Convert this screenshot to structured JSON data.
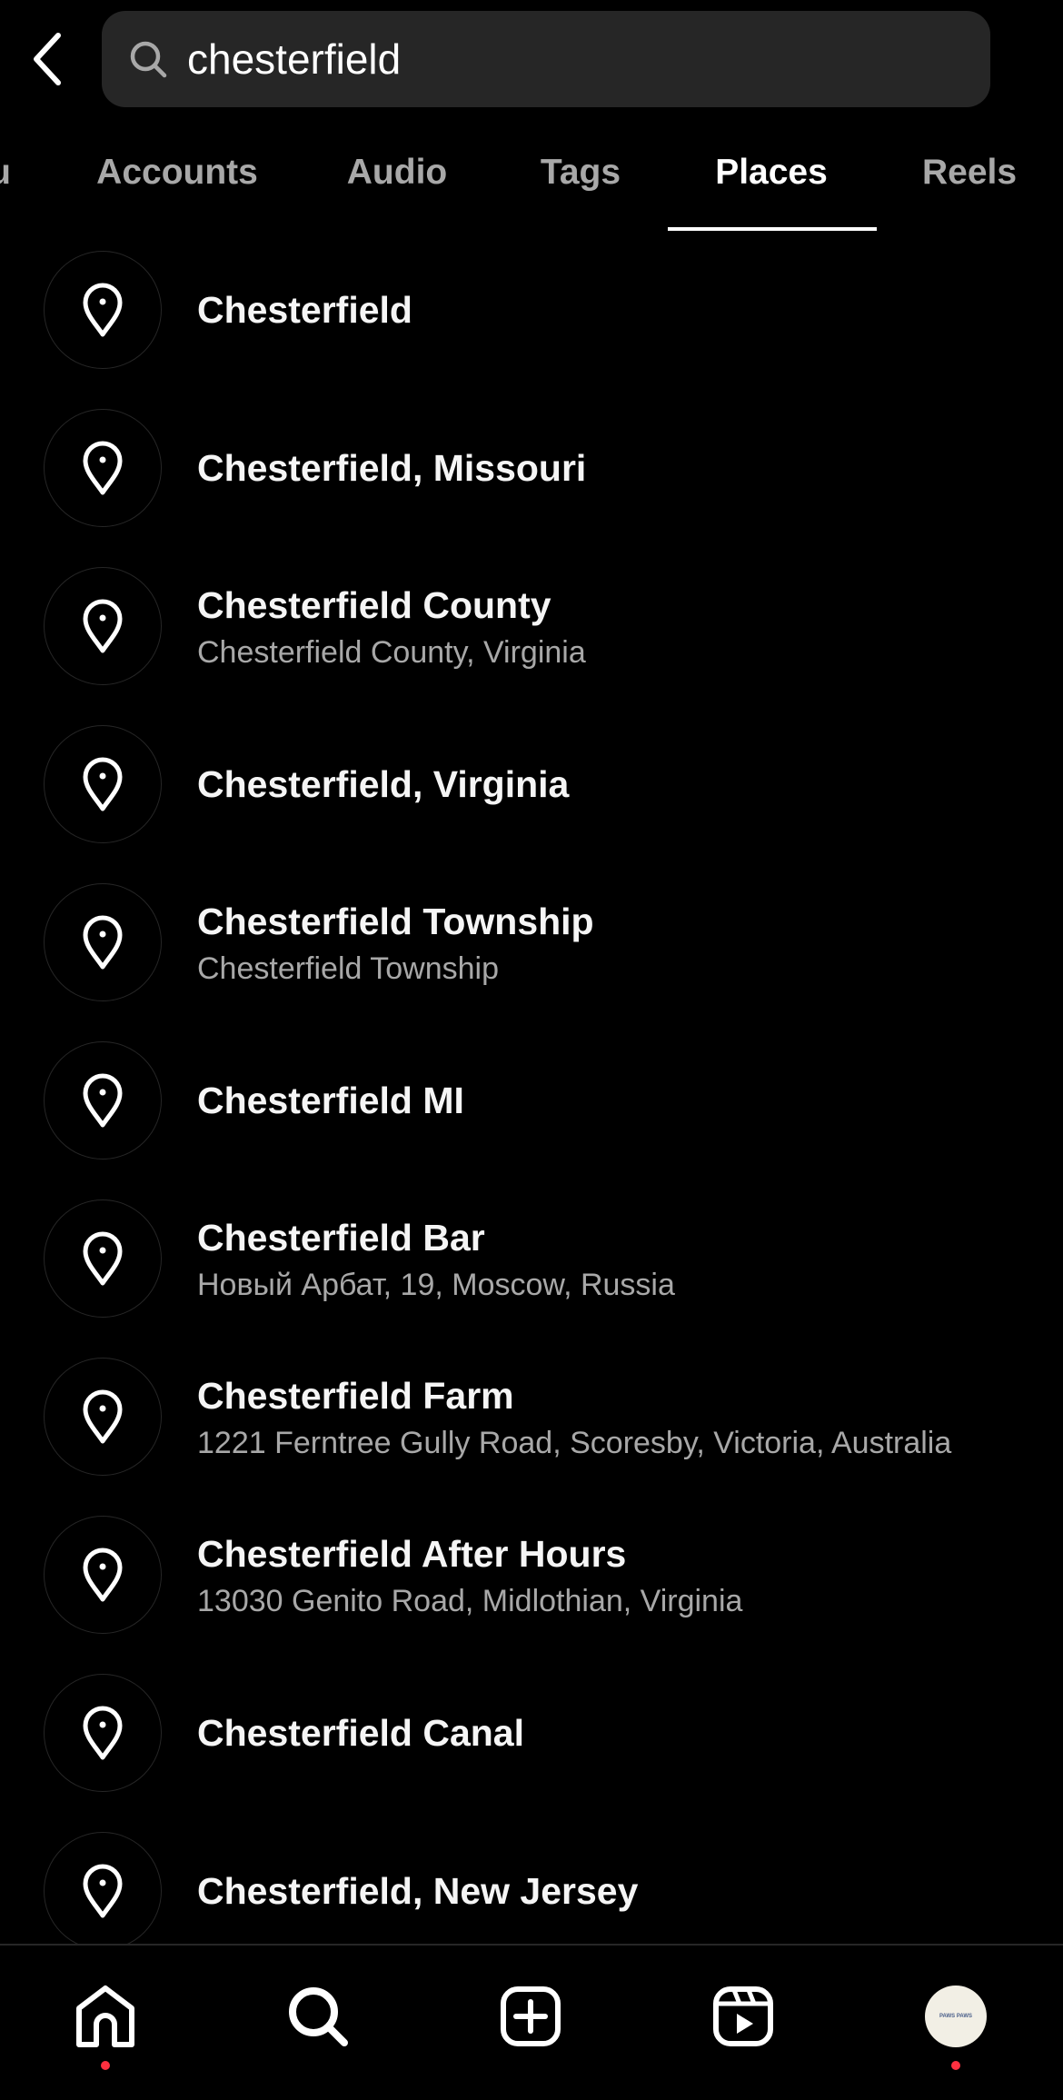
{
  "search": {
    "value": "chesterfield",
    "icon": "search-icon"
  },
  "tabs": [
    {
      "label": "u",
      "active": false
    },
    {
      "label": "Accounts",
      "active": false
    },
    {
      "label": "Audio",
      "active": false
    },
    {
      "label": "Tags",
      "active": false
    },
    {
      "label": "Places",
      "active": true
    },
    {
      "label": "Reels",
      "active": false
    }
  ],
  "places": [
    {
      "title": "Chesterfield",
      "subtitle": ""
    },
    {
      "title": "Chesterfield, Missouri",
      "subtitle": ""
    },
    {
      "title": "Chesterfield County",
      "subtitle": "Chesterfield County, Virginia"
    },
    {
      "title": "Chesterfield, Virginia",
      "subtitle": ""
    },
    {
      "title": "Chesterfield Township",
      "subtitle": "Chesterfield Township"
    },
    {
      "title": "Chesterfield MI",
      "subtitle": ""
    },
    {
      "title": "Chesterfield Bar",
      "subtitle": "Новый Арбат, 19, Moscow, Russia"
    },
    {
      "title": "Chesterfield Farm",
      "subtitle": "1221 Ferntree Gully Road, Scoresby, Victoria, Australia"
    },
    {
      "title": "Chesterfield After Hours",
      "subtitle": "13030 Genito Road, Midlothian, Virginia"
    },
    {
      "title": "Chesterfield Canal",
      "subtitle": ""
    },
    {
      "title": "Chesterfield, New Jersey",
      "subtitle": ""
    }
  ],
  "nav": {
    "items": [
      "home-icon",
      "search-icon",
      "create-icon",
      "reels-icon",
      "profile-avatar"
    ],
    "avatar_text": "PAWS PAWS",
    "notification_color": "#ff3040"
  },
  "colors": {
    "background": "#000000",
    "search_bg": "#262626",
    "secondary_text": "#a8a8a8"
  }
}
